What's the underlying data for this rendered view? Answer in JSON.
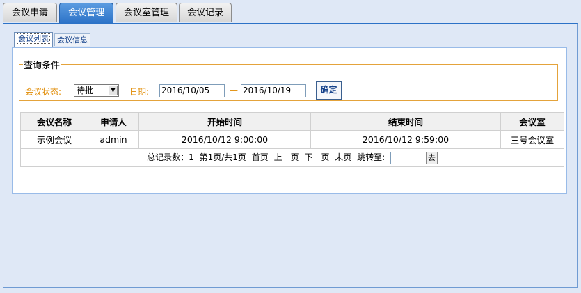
{
  "tabs": [
    {
      "label": "会议申请"
    },
    {
      "label": "会议管理"
    },
    {
      "label": "会议室管理"
    },
    {
      "label": "会议记录"
    }
  ],
  "subtabs": [
    {
      "label": "会议列表"
    },
    {
      "label": "会议信息"
    }
  ],
  "query": {
    "legend": "查询条件",
    "status_label": "会议状态:",
    "status_value": "待批",
    "date_label": "日期:",
    "date_from": "2016/10/05",
    "date_sep": "—",
    "date_to": "2016/10/19",
    "submit_label": "确定"
  },
  "table": {
    "headers": [
      "会议名称",
      "申请人",
      "开始时间",
      "结束时间",
      "会议室"
    ],
    "rows": [
      [
        "示例会议",
        "admin",
        "2016/10/12 9:00:00",
        "2016/10/12 9:59:00",
        "三号会议室"
      ]
    ]
  },
  "pager": {
    "total": "总记录数：1",
    "page_info": "第1页/共1页",
    "first": "首页",
    "prev": "上一页",
    "next": "下一页",
    "last": "末页",
    "jump_label": "跳转至:",
    "go_label": "去"
  },
  "colors": {
    "accent": "#2c72c7",
    "label": "#e08a00",
    "border": "#e4a33b"
  }
}
